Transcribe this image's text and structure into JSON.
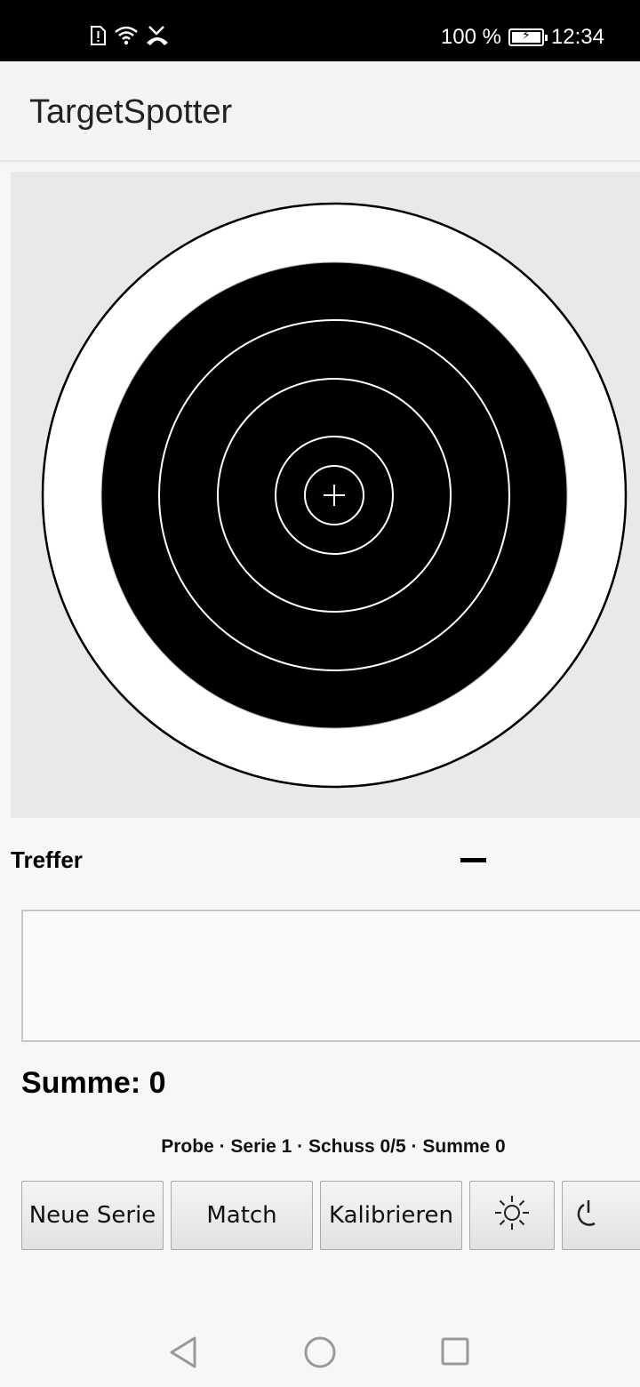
{
  "status_bar": {
    "battery_percent": "100 %",
    "time": "12:34",
    "icons": [
      "sim-alert-icon",
      "wifi-icon",
      "missed-call-icon",
      "battery-charging-icon"
    ]
  },
  "app_bar": {
    "title": "TargetSpotter"
  },
  "target": {
    "description_icon": "shooting-target",
    "colors": {
      "panel": "#e9e9e9",
      "paper": "#ffffff",
      "black_zone": "#000000",
      "ring_line": "#ffffff"
    }
  },
  "hits": {
    "label": "Treffer",
    "value": "—",
    "items": []
  },
  "sum": {
    "label": "Summe: 0"
  },
  "status_line": "Probe · Serie 1 · Schuss 0/5 · Summe 0",
  "buttons": {
    "new_series": "Neue Serie",
    "match": "Match",
    "calibrate": "Kalibrieren",
    "brightness_icon": "sun-icon",
    "reset_icon": "power-reset-icon"
  },
  "nav": {
    "icons": [
      "back-icon",
      "home-icon",
      "recents-icon"
    ]
  }
}
